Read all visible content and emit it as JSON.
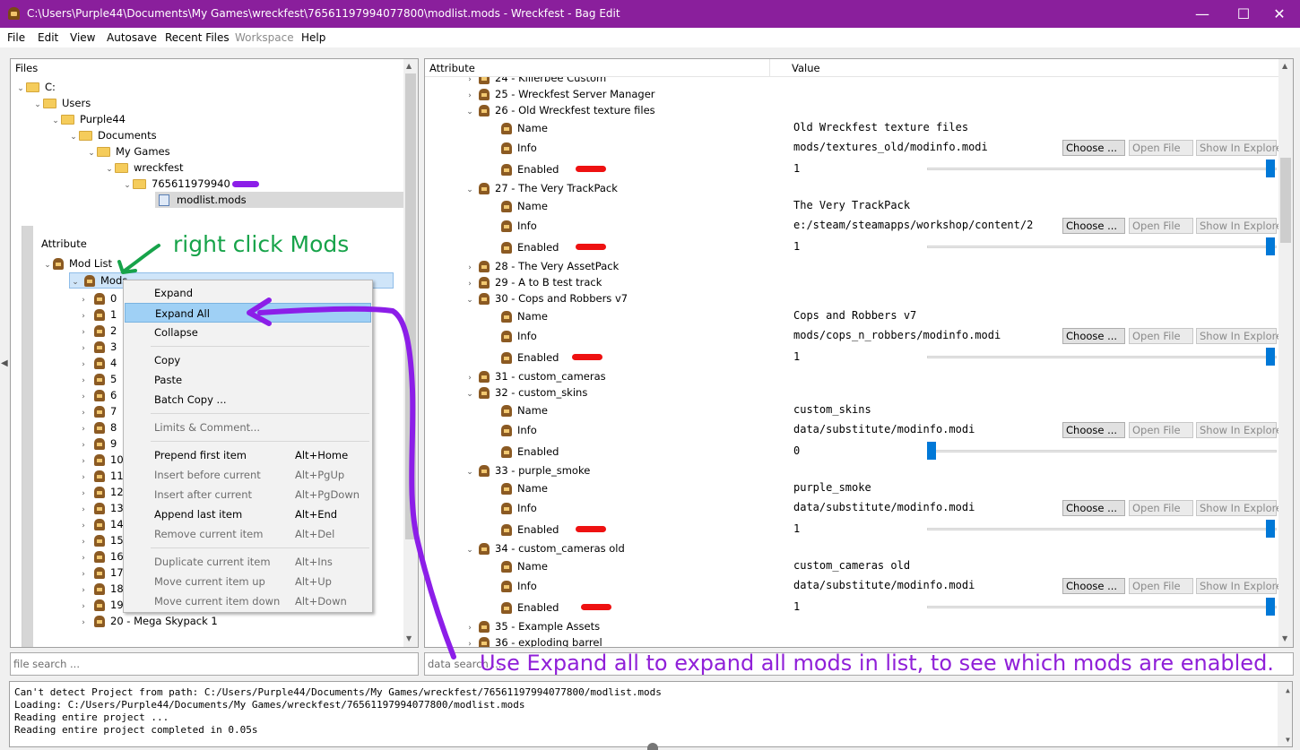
{
  "window": {
    "title": "C:\\Users\\Purple44\\Documents\\My Games\\wreckfest\\76561197994077800\\modlist.mods - Wreckfest - Bag Edit",
    "min_glyph": "—",
    "max_glyph": "☐",
    "close_glyph": "✕"
  },
  "menu": [
    "File",
    "Edit",
    "View",
    "Autosave",
    "Recent Files",
    "Workspace",
    "Help"
  ],
  "files_panel": {
    "header": "Files",
    "tree": [
      {
        "label": "C:",
        "depth": 0,
        "expanded": true
      },
      {
        "label": "Users",
        "depth": 1,
        "expanded": true
      },
      {
        "label": "Purple44",
        "depth": 2,
        "expanded": true
      },
      {
        "label": "Documents",
        "depth": 3,
        "expanded": true
      },
      {
        "label": "My Games",
        "depth": 4,
        "expanded": true
      },
      {
        "label": "wreckfest",
        "depth": 5,
        "expanded": true
      },
      {
        "label": "765611979940",
        "depth": 6,
        "expanded": true
      },
      {
        "label": "modlist.mods",
        "depth": 7,
        "file": true
      }
    ],
    "search_placeholder": "file search ..."
  },
  "left_attr": {
    "header": "Attribute",
    "root": "Mod List",
    "mods": "Mods",
    "items": [
      "0",
      "1",
      "2",
      "3",
      "4",
      "5",
      "6",
      "7",
      "8",
      "9",
      "10",
      "11",
      "12",
      "13",
      "14",
      "15",
      "16",
      "17",
      "18",
      "19",
      "20 - Mega Skypack 1"
    ]
  },
  "context_menu": {
    "items": [
      {
        "label": "Expand",
        "shortcut": "",
        "disabled": false
      },
      {
        "label": "Expand All",
        "shortcut": "",
        "disabled": false,
        "highlight": true
      },
      {
        "label": "Collapse",
        "shortcut": "",
        "disabled": false
      },
      {
        "label": "Copy",
        "shortcut": "",
        "disabled": false
      },
      {
        "label": "Paste",
        "shortcut": "",
        "disabled": false
      },
      {
        "label": "Batch Copy ...",
        "shortcut": "",
        "disabled": false
      },
      {
        "label": "Limits & Comment...",
        "shortcut": "",
        "disabled": true
      },
      {
        "label": "Prepend first item",
        "shortcut": "Alt+Home",
        "disabled": false
      },
      {
        "label": "Insert before current",
        "shortcut": "Alt+PgUp",
        "disabled": true
      },
      {
        "label": "Insert after current",
        "shortcut": "Alt+PgDown",
        "disabled": true
      },
      {
        "label": "Append last item",
        "shortcut": "Alt+End",
        "disabled": false
      },
      {
        "label": "Remove current item",
        "shortcut": "Alt+Del",
        "disabled": true
      },
      {
        "label": "Duplicate current item",
        "shortcut": "Alt+Ins",
        "disabled": true
      },
      {
        "label": "Move current item up",
        "shortcut": "Alt+Up",
        "disabled": true
      },
      {
        "label": "Move current item down",
        "shortcut": "Alt+Down",
        "disabled": true
      }
    ]
  },
  "right_panel": {
    "col_attribute": "Attribute",
    "col_value": "Value",
    "search_placeholder": "data search ...",
    "btn_choose": "Choose ...",
    "btn_open": "Open File",
    "btn_explore": "Show In Explore",
    "label_name": "Name",
    "label_info": "Info",
    "label_enabled": "Enabled",
    "rows": [
      {
        "type": "collapsed",
        "label": "24 - Killerbee Custom"
      },
      {
        "type": "collapsed",
        "label": "25 - Wreckfest Server Manager"
      },
      {
        "type": "expanded",
        "label": "26 - Old Wreckfest texture files"
      },
      {
        "type": "name",
        "value": "Old Wreckfest texture files"
      },
      {
        "type": "info",
        "value": "mods/textures_old/modinfo.modi"
      },
      {
        "type": "enabled",
        "value": "1",
        "level": 1,
        "marked": true
      },
      {
        "type": "expanded",
        "label": "27 - The Very TrackPack"
      },
      {
        "type": "name",
        "value": "The Very TrackPack"
      },
      {
        "type": "info",
        "value": "e:/steam/steamapps/workshop/content/2"
      },
      {
        "type": "enabled",
        "value": "1",
        "level": 1,
        "marked": true
      },
      {
        "type": "collapsed",
        "label": "28 - The Very AssetPack"
      },
      {
        "type": "collapsed",
        "label": "29 - A to B test track"
      },
      {
        "type": "expanded",
        "label": "30 - Cops and Robbers v7"
      },
      {
        "type": "name",
        "value": "Cops and Robbers v7"
      },
      {
        "type": "info",
        "value": "mods/cops_n_robbers/modinfo.modi"
      },
      {
        "type": "enabled",
        "value": "1",
        "level": 1,
        "marked": true
      },
      {
        "type": "collapsed",
        "label": "31 - custom_cameras"
      },
      {
        "type": "expanded",
        "label": "32 - custom_skins"
      },
      {
        "type": "name",
        "value": "custom_skins"
      },
      {
        "type": "info",
        "value": "data/substitute/modinfo.modi"
      },
      {
        "type": "enabled",
        "value": "0",
        "level": 0,
        "marked": false
      },
      {
        "type": "expanded",
        "label": "33 - purple_smoke"
      },
      {
        "type": "name",
        "value": "purple_smoke"
      },
      {
        "type": "info",
        "value": "data/substitute/modinfo.modi"
      },
      {
        "type": "enabled",
        "value": "1",
        "level": 1,
        "marked": true
      },
      {
        "type": "expanded",
        "label": "34 - custom_cameras old"
      },
      {
        "type": "name",
        "value": "custom_cameras old"
      },
      {
        "type": "info",
        "value": "data/substitute/modinfo.modi"
      },
      {
        "type": "enabled",
        "value": "1",
        "level": 1,
        "marked": true
      },
      {
        "type": "collapsed",
        "label": "35 - Example Assets"
      },
      {
        "type": "collapsed",
        "label": "36 - exploding barrel"
      }
    ]
  },
  "log": [
    "Can't detect Project from path: C:/Users/Purple44/Documents/My Games/wreckfest/76561197994077800/modlist.mods",
    "Loading: C:/Users/Purple44/Documents/My Games/wreckfest/76561197994077800/modlist.mods",
    "Reading entire project ...",
    "Reading entire project completed in 0.05s"
  ],
  "annotations": {
    "right_click": "right click Mods",
    "expand_all": "Use Expand all to expand all mods in list, to see which mods are enabled.",
    "green": "#17a34a",
    "purple": "#9020d8",
    "red": "#ee1111"
  }
}
